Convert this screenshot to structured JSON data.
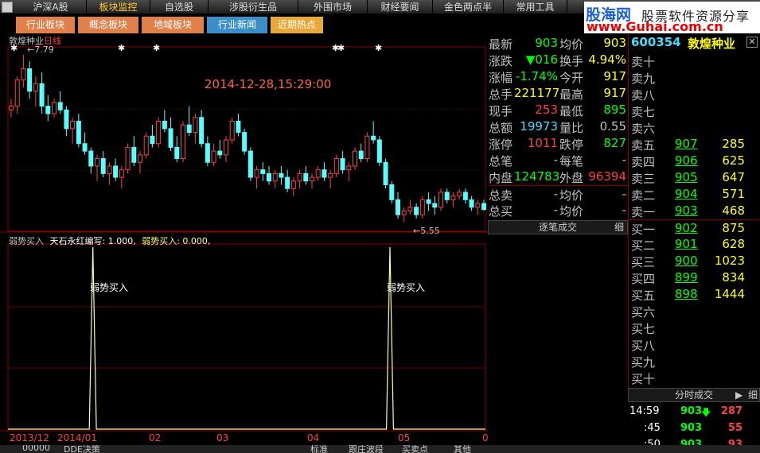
{
  "topbar": {
    "items": [
      "沪深A股",
      "板块监控",
      "自选股",
      "涉股衍生品",
      "外围市场",
      "财经要闻",
      "金色两点半",
      "常用工具"
    ],
    "active_index": 1
  },
  "logo": {
    "name": "股海网",
    "slogan": "股票软件资源分享",
    "url": "www.Guhai.com.cn"
  },
  "tabs": [
    {
      "label": "行业板块",
      "color": "#e0804a"
    },
    {
      "label": "概念板块",
      "color": "#e0804a"
    },
    {
      "label": "地域板块",
      "color": "#e0804a"
    },
    {
      "label": "行业新闻",
      "color": "#3a8fc8"
    },
    {
      "label": "近期热点",
      "color": "#e8a83a"
    }
  ],
  "main_chart": {
    "stock": "敦煌种业",
    "period": "日线",
    "datetime": "2014-12-28,15:29:00",
    "high_label": "7.79",
    "low_label": "5.55",
    "x_labels": [
      "2013/12",
      "2014/01",
      "02",
      "03",
      "04",
      "05",
      "0"
    ]
  },
  "indicator": {
    "name": "弱势买入",
    "params": "天石永红编写: 1.000,",
    "value_label": "弱势买入: 0.000,",
    "signal_label": "弱势买入"
  },
  "chart_data": [
    {
      "type": "candlestick",
      "title": "敦煌种业 日线",
      "annotations": [
        "7.79",
        "5.55",
        "2014-12-28,15:29:00"
      ],
      "x": [
        "2013/12",
        "2014/01",
        "02",
        "03",
        "04",
        "05"
      ],
      "ohlc": [
        [
          7.05,
          7.2,
          6.95,
          7.1
        ],
        [
          7.1,
          7.5,
          7.0,
          7.45
        ],
        [
          7.45,
          7.79,
          7.35,
          7.6
        ],
        [
          7.6,
          7.7,
          7.2,
          7.3
        ],
        [
          7.3,
          7.5,
          7.1,
          7.4
        ],
        [
          7.4,
          7.55,
          7.0,
          7.1
        ],
        [
          7.1,
          7.25,
          6.9,
          7.0
        ],
        [
          7.0,
          7.2,
          6.95,
          7.15
        ],
        [
          7.15,
          7.3,
          7.0,
          7.05
        ],
        [
          7.05,
          7.1,
          6.7,
          6.8
        ],
        [
          6.8,
          6.95,
          6.6,
          6.9
        ],
        [
          6.9,
          7.0,
          6.55,
          6.6
        ],
        [
          6.6,
          6.75,
          6.45,
          6.5
        ],
        [
          6.5,
          6.55,
          6.2,
          6.3
        ],
        [
          6.3,
          6.45,
          6.1,
          6.4
        ],
        [
          6.4,
          6.5,
          6.15,
          6.2
        ],
        [
          6.2,
          6.35,
          6.05,
          6.3
        ],
        [
          6.3,
          6.4,
          6.1,
          6.15
        ],
        [
          6.15,
          6.3,
          6.0,
          6.25
        ],
        [
          6.25,
          6.6,
          6.2,
          6.55
        ],
        [
          6.55,
          6.7,
          6.3,
          6.35
        ],
        [
          6.35,
          6.5,
          6.2,
          6.45
        ],
        [
          6.45,
          6.75,
          6.4,
          6.7
        ],
        [
          6.7,
          6.85,
          6.55,
          6.6
        ],
        [
          6.6,
          6.95,
          6.55,
          6.9
        ],
        [
          6.9,
          7.05,
          6.75,
          6.8
        ],
        [
          6.8,
          6.95,
          6.5,
          6.55
        ],
        [
          6.55,
          6.7,
          6.35,
          6.4
        ],
        [
          6.4,
          6.9,
          6.35,
          6.85
        ],
        [
          6.85,
          7.1,
          6.7,
          6.75
        ],
        [
          6.75,
          7.0,
          6.6,
          6.95
        ],
        [
          6.95,
          7.05,
          6.55,
          6.6
        ],
        [
          6.6,
          6.7,
          6.3,
          6.35
        ],
        [
          6.35,
          6.6,
          6.3,
          6.5
        ],
        [
          6.5,
          6.65,
          6.4,
          6.45
        ],
        [
          6.45,
          6.7,
          6.35,
          6.65
        ],
        [
          6.65,
          6.95,
          6.6,
          6.9
        ],
        [
          6.9,
          7.0,
          6.7,
          6.75
        ],
        [
          6.75,
          6.8,
          6.45,
          6.5
        ],
        [
          6.5,
          6.55,
          6.1,
          6.15
        ],
        [
          6.15,
          6.3,
          6.0,
          6.25
        ],
        [
          6.25,
          6.35,
          6.1,
          6.2
        ],
        [
          6.2,
          6.3,
          6.05,
          6.1
        ],
        [
          6.1,
          6.25,
          6.0,
          6.2
        ],
        [
          6.2,
          6.3,
          6.05,
          6.15
        ],
        [
          6.15,
          6.25,
          5.95,
          6.0
        ],
        [
          6.0,
          6.15,
          5.9,
          6.1
        ],
        [
          6.1,
          6.25,
          6.0,
          6.2
        ],
        [
          6.2,
          6.3,
          6.05,
          6.1
        ],
        [
          6.1,
          6.2,
          6.0,
          6.15
        ],
        [
          6.15,
          6.3,
          6.1,
          6.25
        ],
        [
          6.25,
          6.35,
          6.1,
          6.15
        ],
        [
          6.15,
          6.25,
          6.0,
          6.2
        ],
        [
          6.2,
          6.45,
          6.15,
          6.4
        ],
        [
          6.4,
          6.5,
          6.2,
          6.25
        ],
        [
          6.25,
          6.35,
          6.1,
          6.3
        ],
        [
          6.3,
          6.55,
          6.25,
          6.5
        ],
        [
          6.5,
          6.6,
          6.35,
          6.4
        ],
        [
          6.4,
          6.75,
          6.35,
          6.7
        ],
        [
          6.7,
          6.9,
          6.6,
          6.65
        ],
        [
          6.65,
          6.7,
          6.3,
          6.35
        ],
        [
          6.35,
          6.4,
          6.0,
          6.05
        ],
        [
          6.05,
          6.1,
          5.8,
          5.85
        ],
        [
          5.85,
          5.95,
          5.6,
          5.65
        ],
        [
          5.65,
          5.75,
          5.55,
          5.7
        ],
        [
          5.7,
          5.85,
          5.65,
          5.75
        ],
        [
          5.75,
          5.8,
          5.6,
          5.65
        ],
        [
          5.65,
          5.9,
          5.6,
          5.85
        ],
        [
          5.85,
          5.95,
          5.7,
          5.8
        ],
        [
          5.8,
          5.9,
          5.65,
          5.75
        ],
        [
          5.75,
          6.0,
          5.7,
          5.95
        ],
        [
          5.95,
          6.0,
          5.8,
          5.85
        ],
        [
          5.85,
          5.95,
          5.75,
          5.9
        ],
        [
          5.9,
          6.0,
          5.85,
          5.95
        ],
        [
          5.95,
          6.0,
          5.8,
          5.85
        ],
        [
          5.85,
          5.9,
          5.7,
          5.75
        ],
        [
          5.75,
          5.85,
          5.65,
          5.8
        ],
        [
          5.8,
          5.85,
          5.7,
          5.72
        ]
      ]
    },
    {
      "type": "line",
      "title": "弱势买入",
      "series": [
        {
          "name": "弱势买入",
          "values": [
            0,
            0,
            0,
            0,
            0,
            0,
            0,
            0,
            0,
            0,
            0,
            0,
            0,
            0,
            0,
            0,
            0,
            0,
            0,
            0,
            0,
            0,
            0,
            0,
            1,
            0,
            0,
            0,
            0,
            0,
            0,
            0,
            0,
            0,
            0,
            0,
            0,
            0,
            0,
            0,
            0,
            0,
            0,
            0,
            0,
            0,
            0,
            0,
            0,
            0,
            0,
            0,
            0,
            0,
            0,
            0,
            0,
            0,
            0,
            0,
            0,
            0,
            0,
            0,
            0,
            0,
            0,
            0,
            0,
            0,
            0,
            0,
            0,
            0,
            0,
            0,
            0,
            0,
            0,
            0,
            0,
            0,
            0,
            0,
            0,
            0,
            0,
            0,
            0,
            0,
            0,
            0,
            0,
            0,
            0,
            0,
            0,
            0,
            0,
            0,
            0,
            0,
            0,
            0,
            0,
            0,
            0,
            0,
            1,
            0,
            0,
            0,
            0,
            0,
            0,
            0,
            0,
            0,
            0,
            0,
            0,
            0,
            0,
            0,
            0,
            0,
            0,
            0,
            0,
            0,
            0,
            0,
            0,
            0,
            0,
            0
          ]
        }
      ],
      "ylim": [
        0,
        1
      ]
    }
  ],
  "quote": {
    "rows": [
      {
        "l1": "最新",
        "v1": "903",
        "c1": "#00ff00",
        "l2": "均价",
        "v2": "903",
        "c2": "#ffff00"
      },
      {
        "l1": "涨跌",
        "v1": "▼016",
        "c1": "#00ff00",
        "l2": "换手",
        "v2": "4.94%",
        "c2": "#ffff00"
      },
      {
        "l1": "涨幅",
        "v1": "-1.74%",
        "c1": "#00ff00",
        "l2": "今开",
        "v2": "917",
        "c2": "#ffff00"
      },
      {
        "l1": "总手",
        "v1": "221177",
        "c1": "#ffff00",
        "l2": "最高",
        "v2": "917",
        "c2": "#ffff00"
      },
      {
        "l1": "现手",
        "v1": "253",
        "c1": "#ff4040",
        "l2": "最低",
        "v2": "895",
        "c2": "#00ff00"
      },
      {
        "l1": "总额",
        "v1": "19973",
        "c1": "#40e0ff",
        "l2": "量比",
        "v2": "0.55",
        "c2": "#c0c0c0"
      },
      {
        "l1": "涨停",
        "v1": "1011",
        "c1": "#ff4040",
        "l2": "跌停",
        "v2": "827",
        "c2": "#00ff00"
      },
      {
        "l1": "总笔",
        "v1": "-",
        "c1": "#c0c0c0",
        "l2": "每笔",
        "v2": "-",
        "c2": "#c0c0c0"
      },
      {
        "l1": "内盘",
        "v1": "124783",
        "c1": "#00ff00",
        "l2": "外盘",
        "v2": "96394",
        "c2": "#ff4040"
      },
      {
        "l1": "总卖",
        "v1": "-",
        "c1": "#c0c0c0",
        "l2": "均价",
        "v2": "-",
        "c2": "#c0c0c0"
      },
      {
        "l1": "总买",
        "v1": "-",
        "c1": "#c0c0c0",
        "l2": "均价",
        "v2": "-",
        "c2": "#c0c0c0"
      }
    ],
    "tick_header": "逐笔成交",
    "tick_detail": "细"
  },
  "book": {
    "code": "600354",
    "name": "敦煌种业",
    "close_icon": "close-icon",
    "asks": [
      {
        "label": "卖十",
        "price": "",
        "vol": ""
      },
      {
        "label": "卖九",
        "price": "",
        "vol": ""
      },
      {
        "label": "卖八",
        "price": "",
        "vol": ""
      },
      {
        "label": "卖七",
        "price": "",
        "vol": ""
      },
      {
        "label": "卖六",
        "price": "",
        "vol": ""
      },
      {
        "label": "卖五",
        "price": "907",
        "vol": "285"
      },
      {
        "label": "卖四",
        "price": "906",
        "vol": "625"
      },
      {
        "label": "卖三",
        "price": "905",
        "vol": "647"
      },
      {
        "label": "卖二",
        "price": "904",
        "vol": "571"
      },
      {
        "label": "卖一",
        "price": "903",
        "vol": "468"
      }
    ],
    "bids": [
      {
        "label": "买一",
        "price": "902",
        "vol": "875"
      },
      {
        "label": "买二",
        "price": "901",
        "vol": "628"
      },
      {
        "label": "买三",
        "price": "900",
        "vol": "1023"
      },
      {
        "label": "买四",
        "price": "899",
        "vol": "834"
      },
      {
        "label": "买五",
        "price": "898",
        "vol": "1444"
      },
      {
        "label": "买六",
        "price": "",
        "vol": ""
      },
      {
        "label": "买七",
        "price": "",
        "vol": ""
      },
      {
        "label": "买八",
        "price": "",
        "vol": ""
      },
      {
        "label": "买九",
        "price": "",
        "vol": ""
      },
      {
        "label": "买十",
        "price": "",
        "vol": ""
      }
    ]
  },
  "trades": {
    "header": "分时成交",
    "detail": "细",
    "rows": [
      {
        "time": "14:59",
        "price": "903",
        "arrow": "🡇",
        "vol": "287"
      },
      {
        "time": ":45",
        "price": "903",
        "arrow": "",
        "vol": "55"
      },
      {
        "time": ":50",
        "price": "903",
        "arrow": "",
        "vol": "93"
      }
    ]
  },
  "bottombar": {
    "items": [
      "00000",
      "DDE决策",
      "",
      "",
      "",
      "",
      "标准",
      "跟庄波段",
      "买卖点",
      "其他"
    ]
  }
}
